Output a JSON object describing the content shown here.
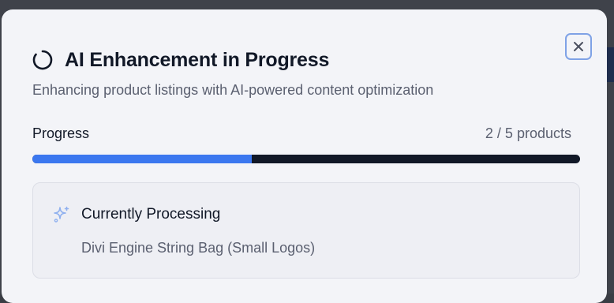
{
  "dialog": {
    "title": "AI Enhancement in Progress",
    "subtitle": "Enhancing product listings with AI-powered content optimization",
    "close_icon": "close-icon",
    "spinner_icon": "loading-spinner-icon"
  },
  "progress": {
    "label": "Progress",
    "count_text": "2 / 5 products",
    "completed": 2,
    "total": 5,
    "fraction": 0.4
  },
  "processing": {
    "icon": "sparkles-icon",
    "title": "Currently Processing",
    "product_name": "Divi Engine String Bag (Small Logos)"
  },
  "colors": {
    "accent": "#3b77ef",
    "track": "#111827",
    "sparkle": "#8fb0ef",
    "close_border": "#7fa2e6"
  }
}
